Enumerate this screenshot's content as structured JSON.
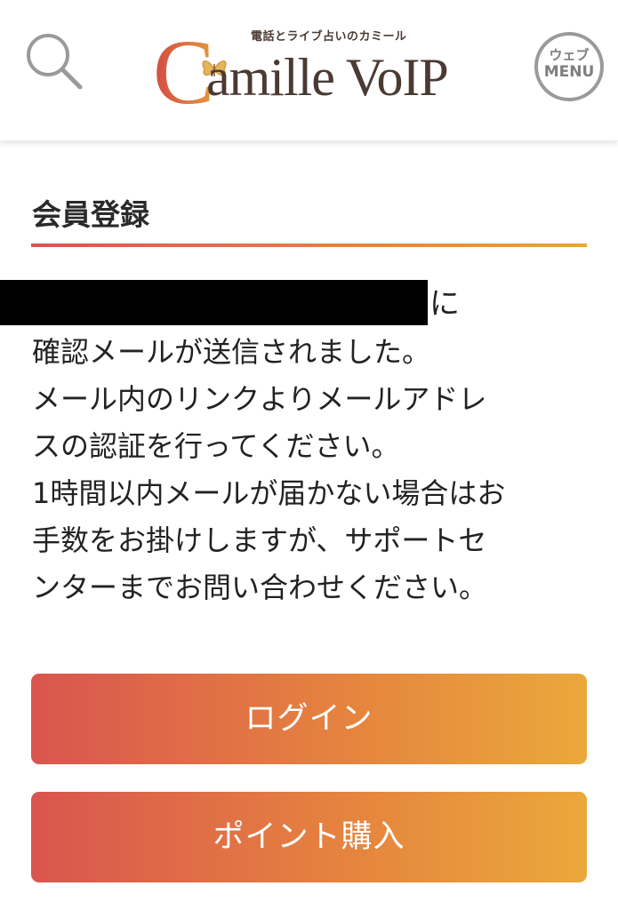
{
  "header": {
    "search_icon": "search-icon",
    "logo": {
      "tagline": "電話とライブ占いのカミール",
      "wordmark": "amille VoIP",
      "initial": "C",
      "butterfly_icon": "butterfly-icon"
    },
    "menu": {
      "top_label": "ウェブ",
      "bottom_label": "MENU"
    }
  },
  "main": {
    "section_title": "会員登録",
    "message_tail": "に",
    "message_lines": [
      "確認メールが送信されました。",
      "メール内のリンクよりメールアドレ",
      "スの認証を行ってください。",
      "1時間以内メールが届かない場合はお",
      "手数をお掛けしますが、サポートセ",
      "ンターまでお問い合わせください。"
    ],
    "buttons": {
      "login_label": "ログイン",
      "buy_points_label": "ポイント購入"
    }
  },
  "colors": {
    "gradient_start": "#d9554f",
    "gradient_end": "#eaa83b",
    "logo_brown": "#4a3a32",
    "menu_gray": "#9a9a9a"
  }
}
